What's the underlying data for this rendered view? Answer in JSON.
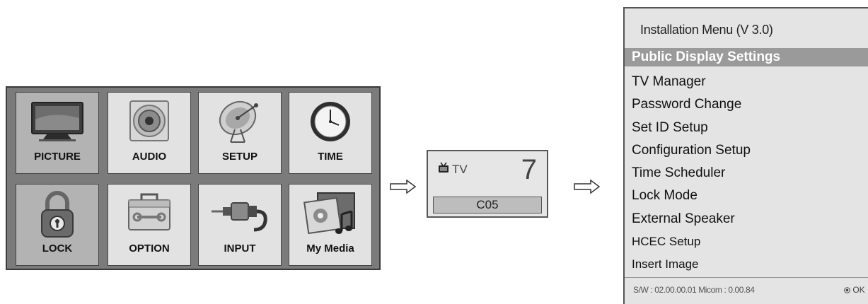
{
  "main_menu": {
    "tiles": [
      {
        "label": "PICTURE",
        "icon": "monitor-icon",
        "selected": true
      },
      {
        "label": "AUDIO",
        "icon": "speaker-icon",
        "selected": false
      },
      {
        "label": "SETUP",
        "icon": "satellite-dish-icon",
        "selected": false
      },
      {
        "label": "TIME",
        "icon": "clock-icon",
        "selected": false
      },
      {
        "label": "LOCK",
        "icon": "padlock-icon",
        "selected": true
      },
      {
        "label": "OPTION",
        "icon": "toolbox-icon",
        "selected": false
      },
      {
        "label": "INPUT",
        "icon": "cable-plug-icon",
        "selected": false
      },
      {
        "label": "My Media",
        "icon": "photo-music-icon",
        "selected": false
      }
    ]
  },
  "channel_box": {
    "source_label": "TV",
    "channel_number": "7",
    "channel_name": "C05"
  },
  "installation_menu": {
    "title": "Installation Menu (V 3.0)",
    "items": [
      {
        "label": "Public Display Settings",
        "selected": true
      },
      {
        "label": "TV Manager"
      },
      {
        "label": "Password Change"
      },
      {
        "label": "Set ID Setup"
      },
      {
        "label": "Configuration Setup"
      },
      {
        "label": "Time Scheduler"
      },
      {
        "label": "Lock Mode"
      },
      {
        "label": "External Speaker"
      },
      {
        "label": "HCEC Setup"
      },
      {
        "label": "Insert Image"
      }
    ],
    "footer_version": "S/W : 02.00.00.01 Micom : 0.00.84",
    "ok_label": "OK"
  },
  "colors": {
    "menu_frame": "#7b7b7b",
    "tile_normal": "#e2e2e2",
    "tile_selected": "#b3b3b3",
    "highlight": "#9a9a9a"
  }
}
